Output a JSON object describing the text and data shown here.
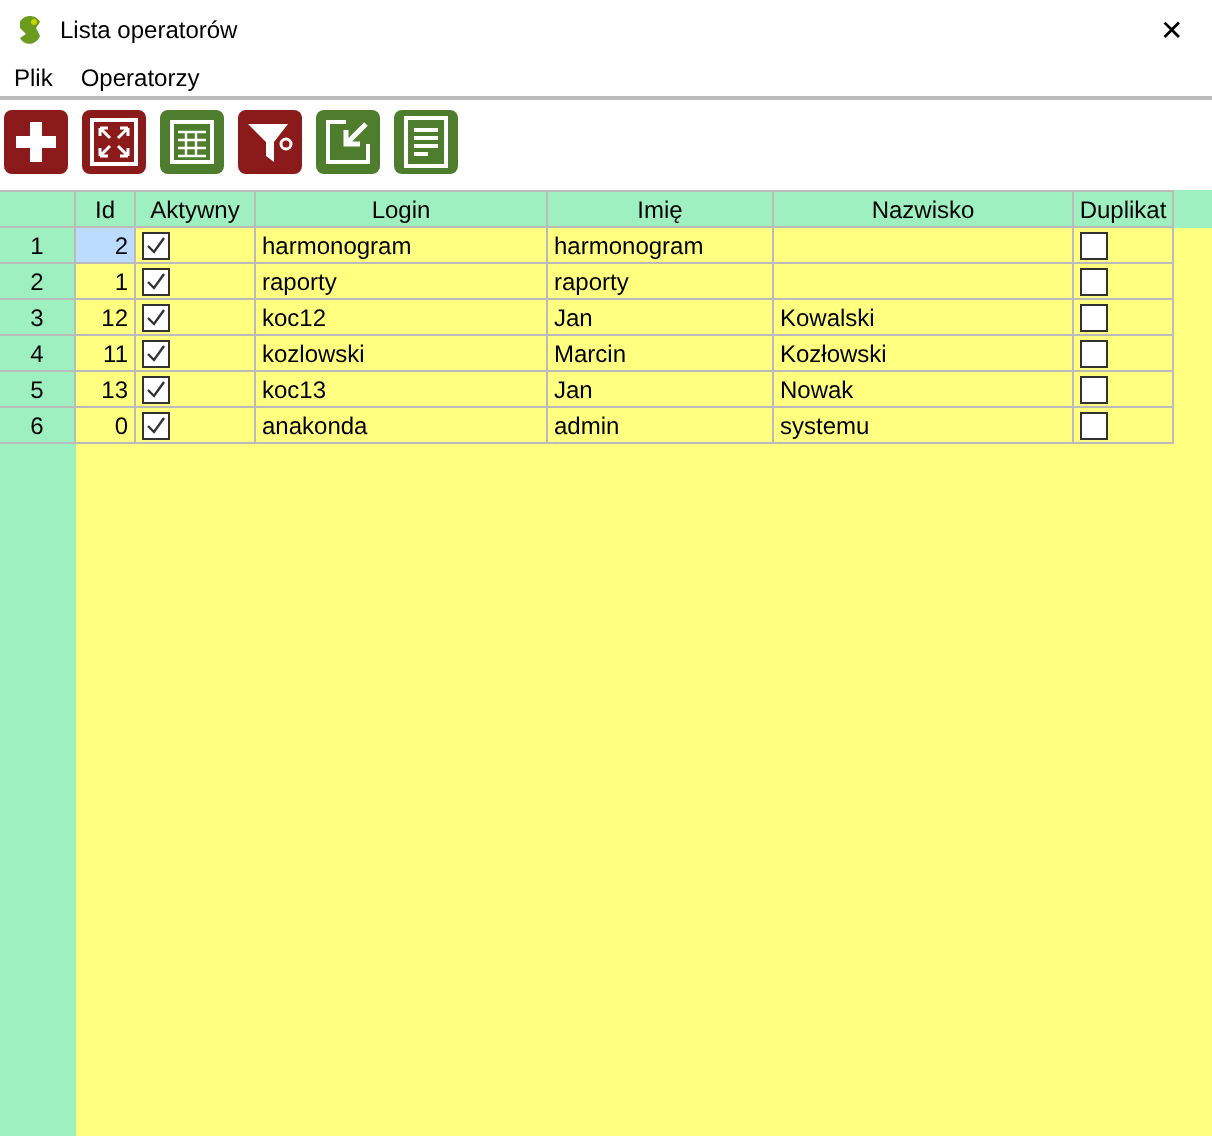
{
  "window": {
    "title": "Lista operatorów",
    "close": "✕"
  },
  "menu": [
    "Plik",
    "Operatorzy"
  ],
  "toolbar": [
    {
      "kind": "plus",
      "color": "#8b1a1a"
    },
    {
      "kind": "expand",
      "color": "#8b1a1a"
    },
    {
      "kind": "table",
      "color": "#4e7d2e"
    },
    {
      "kind": "filter",
      "color": "#8b1a1a"
    },
    {
      "kind": "import",
      "color": "#4e7d2e"
    },
    {
      "kind": "document",
      "color": "#4e7d2e"
    }
  ],
  "table": {
    "columns": [
      "Id",
      "Aktywny",
      "Login",
      "Imię",
      "Nazwisko",
      "Duplikat"
    ],
    "rows": [
      {
        "number": "1",
        "id": "2",
        "active": true,
        "login": "harmonogram",
        "first_name": "harmonogram",
        "last_name": "",
        "duplicate": false,
        "selected": true
      },
      {
        "number": "2",
        "id": "1",
        "active": true,
        "login": "raporty",
        "first_name": "raporty",
        "last_name": "",
        "duplicate": false,
        "selected": false
      },
      {
        "number": "3",
        "id": "12",
        "active": true,
        "login": "koc12",
        "first_name": "Jan",
        "last_name": "Kowalski",
        "duplicate": false,
        "selected": false
      },
      {
        "number": "4",
        "id": "11",
        "active": true,
        "login": "kozlowski",
        "first_name": "Marcin",
        "last_name": "Kozłowski",
        "duplicate": false,
        "selected": false
      },
      {
        "number": "5",
        "id": "13",
        "active": true,
        "login": "koc13",
        "first_name": "Jan",
        "last_name": "Nowak",
        "duplicate": false,
        "selected": false
      },
      {
        "number": "6",
        "id": "0",
        "active": true,
        "login": "anakonda",
        "first_name": "admin",
        "last_name": "systemu",
        "duplicate": false,
        "selected": false
      }
    ]
  }
}
